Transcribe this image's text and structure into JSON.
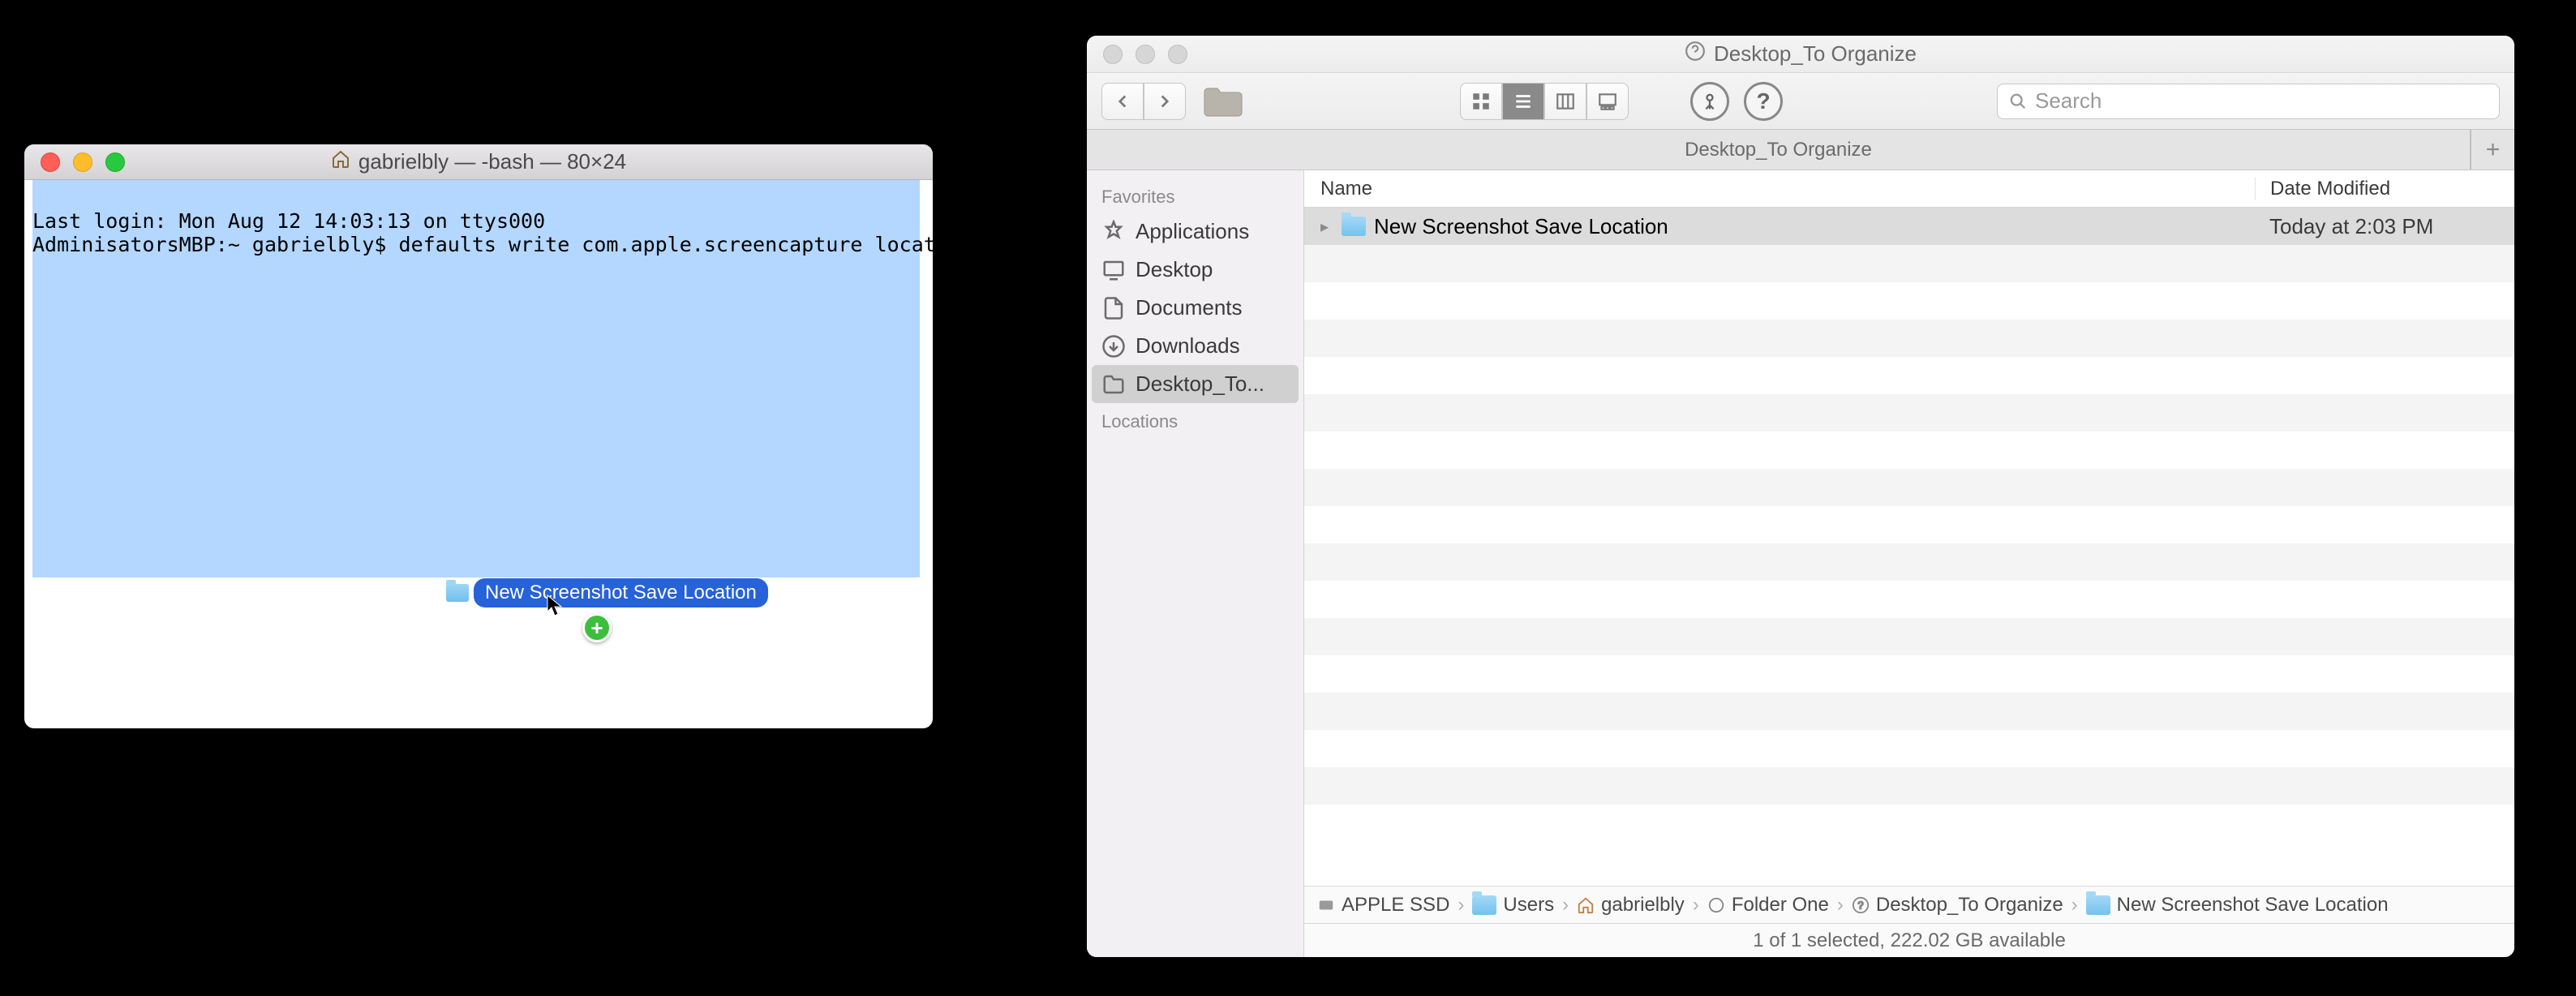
{
  "terminal": {
    "title": "gabrielbly — -bash — 80×24",
    "line1": "Last login: Mon Aug 12 14:03:13 on ttys000",
    "line2": "AdminisatorsMBP:~ gabrielbly$ defaults write com.apple.screencapture location ",
    "drag_label": "New Screenshot Save Location"
  },
  "finder": {
    "window_title": "Desktop_To Organize",
    "search_placeholder": "Search",
    "tab_label": "Desktop_To Organize",
    "sidebar": {
      "favorites_label": "Favorites",
      "locations_label": "Locations",
      "items": [
        {
          "label": "Applications"
        },
        {
          "label": "Desktop"
        },
        {
          "label": "Documents"
        },
        {
          "label": "Downloads"
        },
        {
          "label": "Desktop_To..."
        }
      ]
    },
    "columns": {
      "name": "Name",
      "date": "Date Modified"
    },
    "row": {
      "name": "New Screenshot Save Location",
      "date": "Today at 2:03 PM"
    },
    "path": [
      "APPLE SSD",
      "Users",
      "gabrielbly",
      "Folder One",
      "Desktop_To Organize",
      "New Screenshot Save Location"
    ],
    "status": "1 of 1 selected, 222.02 GB available"
  }
}
